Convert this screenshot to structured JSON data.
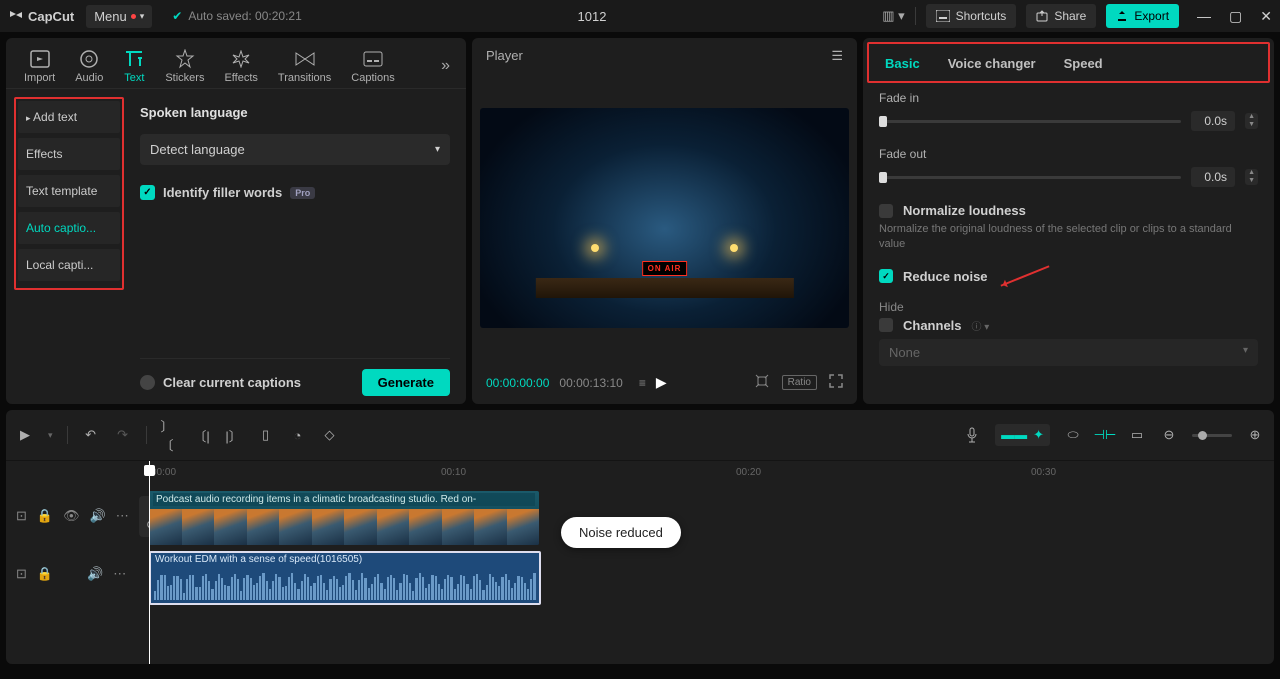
{
  "titlebar": {
    "app_name": "CapCut",
    "menu_label": "Menu",
    "autosave": "Auto saved: 00:20:21",
    "project_title": "1012",
    "shortcuts": "Shortcuts",
    "share": "Share",
    "export": "Export"
  },
  "media_tabs": {
    "import": "Import",
    "audio": "Audio",
    "text": "Text",
    "stickers": "Stickers",
    "effects": "Effects",
    "transitions": "Transitions",
    "captions": "Captions"
  },
  "sidebar": {
    "add_text": "Add text",
    "effects": "Effects",
    "text_template": "Text template",
    "auto_captions": "Auto captio...",
    "local_captions": "Local capti..."
  },
  "captions_panel": {
    "heading": "Spoken language",
    "detect": "Detect language",
    "identify": "Identify filler words",
    "pro": "Pro",
    "clear": "Clear current captions",
    "generate": "Generate"
  },
  "player": {
    "title": "Player",
    "onair": "ON AIR",
    "tc_current": "00:00:00:00",
    "tc_total": "00:00:13:10",
    "ratio": "Ratio"
  },
  "props": {
    "tab_basic": "Basic",
    "tab_voice": "Voice changer",
    "tab_speed": "Speed",
    "fade_in": "Fade in",
    "fade_in_val": "0.0s",
    "fade_out": "Fade out",
    "fade_out_val": "0.0s",
    "normalize": "Normalize loudness",
    "normalize_desc": "Normalize the original loudness of the selected clip or clips to a standard value",
    "reduce_noise": "Reduce noise",
    "hide": "Hide",
    "channels": "Channels",
    "none": "None"
  },
  "timeline": {
    "ruler": {
      "t0": "00:00",
      "t1": "00:10",
      "t2": "00:20",
      "t3": "00:30"
    },
    "clip1_label": "Podcast audio recording items in a climatic broadcasting studio. Red on-",
    "clip2_label": "Workout EDM with a sense of speed(1016505)",
    "cover": "Cover",
    "toast": "Noise reduced"
  }
}
